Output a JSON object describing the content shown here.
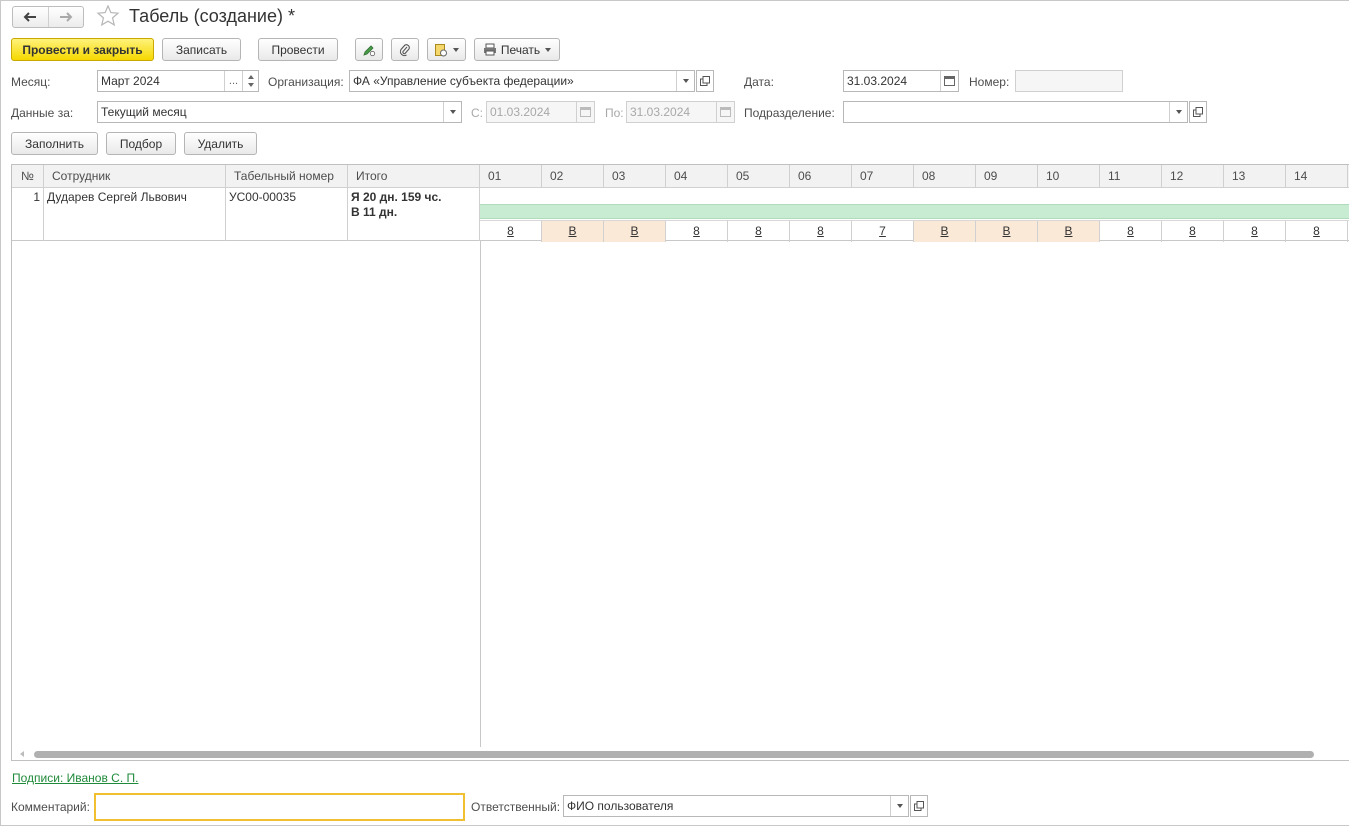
{
  "title": "Табель (создание) *",
  "toolbar": {
    "post_close": "Провести и закрыть",
    "save": "Записать",
    "post": "Провести",
    "print": "Печать"
  },
  "form": {
    "month_label": "Месяц:",
    "month_value": "Март 2024",
    "month_dots": "...",
    "org_label": "Организация:",
    "org_value": "ФА «Управление субъекта федерации»",
    "date_label": "Дата:",
    "date_value": "31.03.2024",
    "number_label": "Номер:",
    "number_value": "",
    "data_for_label": "Данные за:",
    "data_for_value": "Текущий месяц",
    "from_label": "С:",
    "from_value": "01.03.2024",
    "to_label": "По:",
    "to_value": "31.03.2024",
    "division_label": "Подразделение:",
    "division_value": ""
  },
  "actions": {
    "fill": "Заполнить",
    "select": "Подбор",
    "delete": "Удалить"
  },
  "table": {
    "columns": [
      "№",
      "Сотрудник",
      "Табельный номер",
      "Итого"
    ],
    "days": [
      "01",
      "02",
      "03",
      "04",
      "05",
      "06",
      "07",
      "08",
      "09",
      "10",
      "11",
      "12",
      "13",
      "14"
    ],
    "rows": [
      {
        "num": "1",
        "employee": "Дударев Сергей Львович",
        "tab_number": "УС00-00035",
        "total_line1": "Я 20 дн. 159 чс.",
        "total_line2": "В 11 дн.",
        "marks": [
          "8",
          "В",
          "В",
          "8",
          "8",
          "8",
          "7",
          "В",
          "В",
          "В",
          "8",
          "8",
          "8",
          "8"
        ]
      }
    ]
  },
  "footer": {
    "signatures_link": "Подписи: Иванов С. П.",
    "comment_label": "Комментарий:",
    "comment_value": "",
    "responsible_label": "Ответственный:",
    "responsible_value": "ФИО пользователя"
  },
  "colors": {
    "primary_button": "#f5d800",
    "schedule_bar": "#c7ecd2",
    "weekend_cell": "#fbe9d7",
    "link": "#1f8a3a",
    "comment_focus": "#f0c030"
  },
  "icons": [
    "back-arrow-icon",
    "forward-arrow-icon",
    "favorite-star-icon",
    "pencil-icon",
    "paperclip-icon",
    "create-based-icon",
    "printer-icon",
    "calendar-icon",
    "open-form-icon"
  ]
}
